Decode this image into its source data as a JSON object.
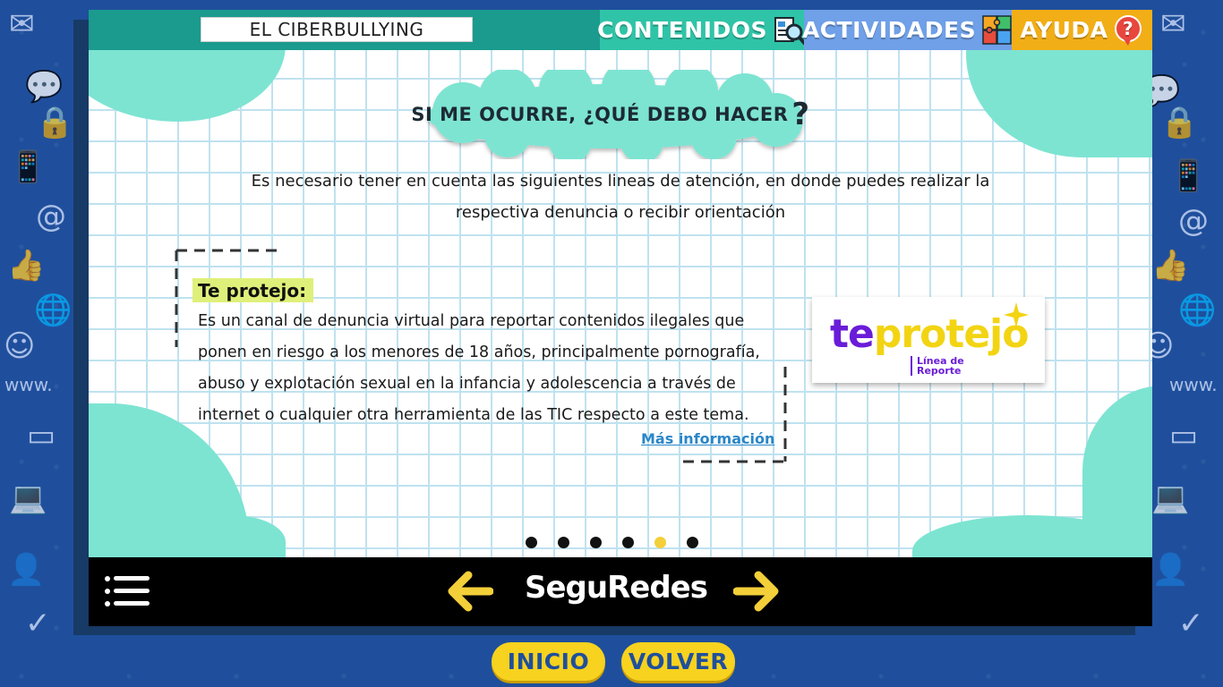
{
  "header": {
    "title": "EL CIBERBULLYING",
    "nav": [
      {
        "label": "CONTENIDOS",
        "icon": "magnifier-document-icon"
      },
      {
        "label": "ACTIVIDADES",
        "icon": "puzzle-icon"
      },
      {
        "label": "AYUDA",
        "icon": "question-bubble-icon"
      }
    ]
  },
  "main": {
    "heading_part1": "SI ME OCURRE, ",
    "heading_part2": "¿QUÉ DEBO HACER",
    "heading_part3": "?",
    "intro": "Es necesario tener en cuenta las siguientes lineas de atención, en donde puedes realizar la respectiva denuncia o recibir orientación",
    "card": {
      "label": "Te protejo:",
      "description": "Es un canal de denuncia virtual para reportar contenidos ilegales que ponen en riesgo a los menores de 18 años, principalmente pornografía, abuso y explotación sexual en la infancia y adolescencia a través de internet o cualquier otra herramienta de las TIC respecto a este tema.",
      "link": "Más información"
    },
    "logo": {
      "part1": "te",
      "part2": "protejo",
      "sub1": "Línea de",
      "sub2": "Reporte"
    },
    "pagination": {
      "total": 6,
      "current": 5
    }
  },
  "footer": {
    "brand": "SeguRedes",
    "buttons": {
      "inicio": "INICIO",
      "volver": "VOLVER"
    }
  },
  "colors": {
    "topbar": "#1a9b8d",
    "contenidos": "#2fc4a7",
    "actividades": "#6fa0e8",
    "ayuda": "#f2ae16",
    "accent_yellow": "#f7d21f",
    "mint": "#7de4d2",
    "background": "#1f4f9c"
  }
}
